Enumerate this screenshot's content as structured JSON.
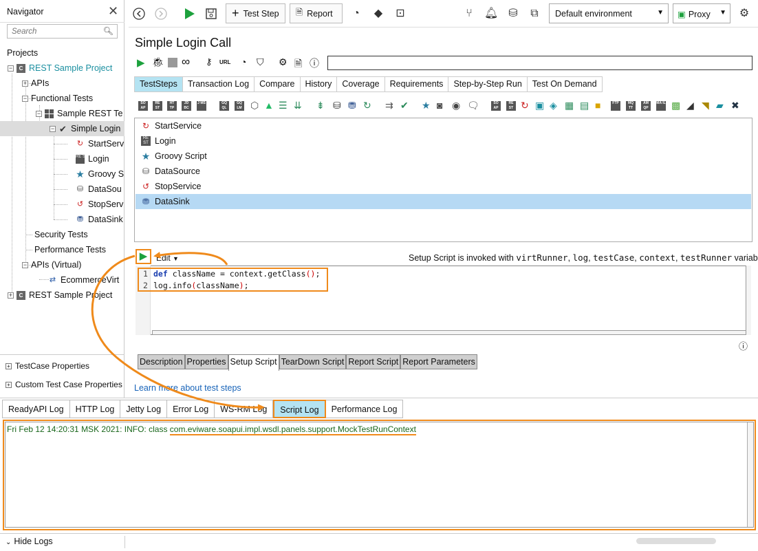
{
  "navigator": {
    "title": "Navigator",
    "search_placeholder": "Search",
    "projects_label": "Projects",
    "tree": [
      {
        "label": "REST Sample Project",
        "kind": "project",
        "highlight": true
      },
      {
        "label": "APIs",
        "kind": "folder"
      },
      {
        "label": "Functional Tests",
        "kind": "folder"
      },
      {
        "label": "Sample REST Te",
        "kind": "suite"
      },
      {
        "label": "Simple Login",
        "kind": "case"
      },
      {
        "label": "StartServ",
        "kind": "step"
      },
      {
        "label": "Login",
        "kind": "step"
      },
      {
        "label": "Groovy S",
        "kind": "step"
      },
      {
        "label": "DataSou",
        "kind": "step"
      },
      {
        "label": "StopServ",
        "kind": "step"
      },
      {
        "label": "DataSink",
        "kind": "step"
      },
      {
        "label": "Security Tests",
        "kind": "folder"
      },
      {
        "label": "Performance Tests",
        "kind": "folder"
      },
      {
        "label": "APIs (Virtual)",
        "kind": "folder"
      },
      {
        "label": "EcommerceVirt",
        "kind": "virt"
      },
      {
        "label": "REST Sample Project",
        "kind": "project2"
      }
    ],
    "testcase_properties": "TestCase Properties",
    "custom_properties": "Custom Test Case Properties"
  },
  "toolbar": {
    "test_step_label": "Test Step",
    "report_label": "Report",
    "environment": "Default environment",
    "proxy": "Proxy"
  },
  "testcase": {
    "title": "Simple Login Call",
    "url_label": "URL",
    "tabs": [
      "TestSteps",
      "Transaction Log",
      "Compare",
      "History",
      "Coverage",
      "Requirements",
      "Step-by-Step Run",
      "Test On Demand"
    ],
    "active_tab": "TestSteps",
    "steps": [
      {
        "label": "StartService",
        "icon": "service-icon"
      },
      {
        "label": "Login",
        "icon": "rest-icon"
      },
      {
        "label": "Groovy Script",
        "icon": "star-icon"
      },
      {
        "label": "DataSource",
        "icon": "datasource-icon"
      },
      {
        "label": "StopService",
        "icon": "service-icon"
      },
      {
        "label": "DataSink",
        "icon": "datasink-icon",
        "selected": true
      }
    ]
  },
  "script": {
    "edit_label": "Edit",
    "hint_prefix": "Setup Script is invoked with ",
    "hint_vars": "virtRunner",
    "hint_rest": ", ",
    "hint_vars2": "log",
    "hint_vars3": "testCase",
    "hint_vars4": "context",
    "hint_and": " variables",
    "hint_vars5": "testRunner",
    "code_lines": [
      {
        "num": "1",
        "kw": "def",
        "text": " className = context.getClass",
        "paren": "()",
        "tail": ";"
      },
      {
        "num": "2",
        "kw": "",
        "text": "log.info",
        "paren": "(",
        "mid": "className",
        "paren2": ")",
        "tail": ";"
      }
    ],
    "tabs": [
      "Description",
      "Properties",
      "Setup Script",
      "TearDown Script",
      "Report Script",
      "Report Parameters"
    ],
    "active_tab": "Setup Script",
    "learn_more": "Learn more about test steps"
  },
  "logs": {
    "tabs": [
      "ReadyAPI Log",
      "HTTP Log",
      "Jetty Log",
      "Error Log",
      "WS-RM Log",
      "Script Log",
      "Performance Log"
    ],
    "active_tab": "Script Log",
    "line_prefix": "Fri Feb 12 14:20:31 MSK 2021: INFO: class ",
    "line_class": "com.eviware.soapui.impl.wsdl.panels.support.MockTestRunContext",
    "hide_logs": "Hide Logs"
  },
  "colors": {
    "accent_orange": "#ef8a1b",
    "active_tab": "#b4e3f2",
    "selected_row": "#b6d9f4",
    "run_green": "#1da13d",
    "project_teal": "#1a8fa0"
  }
}
